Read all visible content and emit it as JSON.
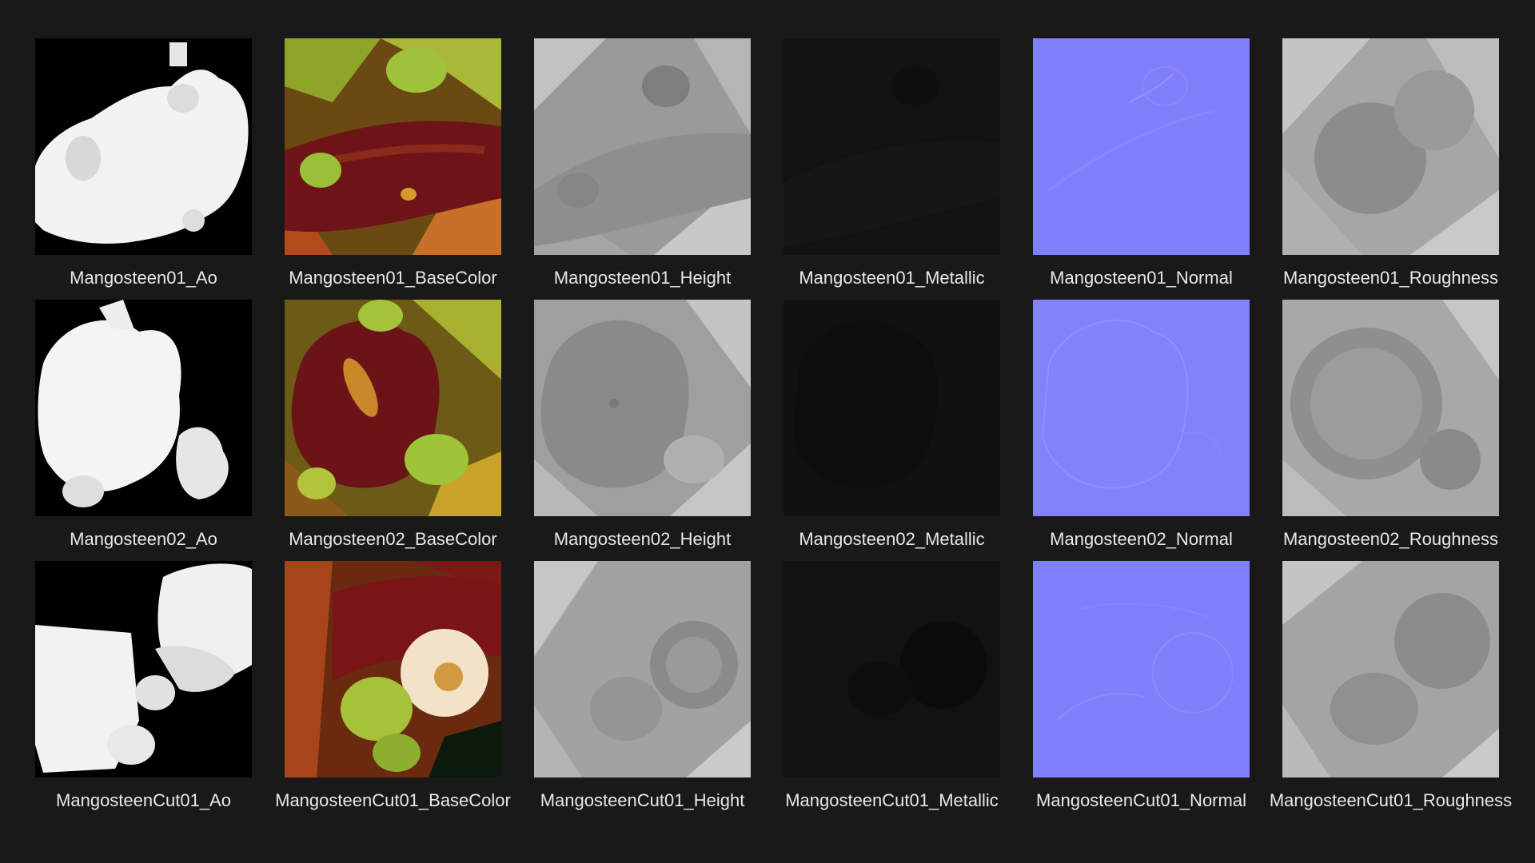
{
  "colors": {
    "background": "#191919",
    "label_text": "#e8e8e8"
  },
  "rows": [
    {
      "tiles": [
        {
          "label": "Mangosteen01_Ao",
          "kind": "ao"
        },
        {
          "label": "Mangosteen01_BaseColor",
          "kind": "basecolor"
        },
        {
          "label": "Mangosteen01_Height",
          "kind": "height"
        },
        {
          "label": "Mangosteen01_Metallic",
          "kind": "metallic"
        },
        {
          "label": "Mangosteen01_Normal",
          "kind": "normal"
        },
        {
          "label": "Mangosteen01_Roughness",
          "kind": "roughness"
        }
      ]
    },
    {
      "tiles": [
        {
          "label": "Mangosteen02_Ao",
          "kind": "ao"
        },
        {
          "label": "Mangosteen02_BaseColor",
          "kind": "basecolor"
        },
        {
          "label": "Mangosteen02_Height",
          "kind": "height"
        },
        {
          "label": "Mangosteen02_Metallic",
          "kind": "metallic"
        },
        {
          "label": "Mangosteen02_Normal",
          "kind": "normal"
        },
        {
          "label": "Mangosteen02_Roughness",
          "kind": "roughness"
        }
      ]
    },
    {
      "tiles": [
        {
          "label": "MangosteenCut01_Ao",
          "kind": "ao"
        },
        {
          "label": "MangosteenCut01_BaseColor",
          "kind": "basecolor"
        },
        {
          "label": "MangosteenCut01_Height",
          "kind": "height"
        },
        {
          "label": "MangosteenCut01_Metallic",
          "kind": "metallic"
        },
        {
          "label": "MangosteenCut01_Normal",
          "kind": "normal"
        },
        {
          "label": "MangosteenCut01_Roughness",
          "kind": "roughness"
        }
      ]
    }
  ]
}
